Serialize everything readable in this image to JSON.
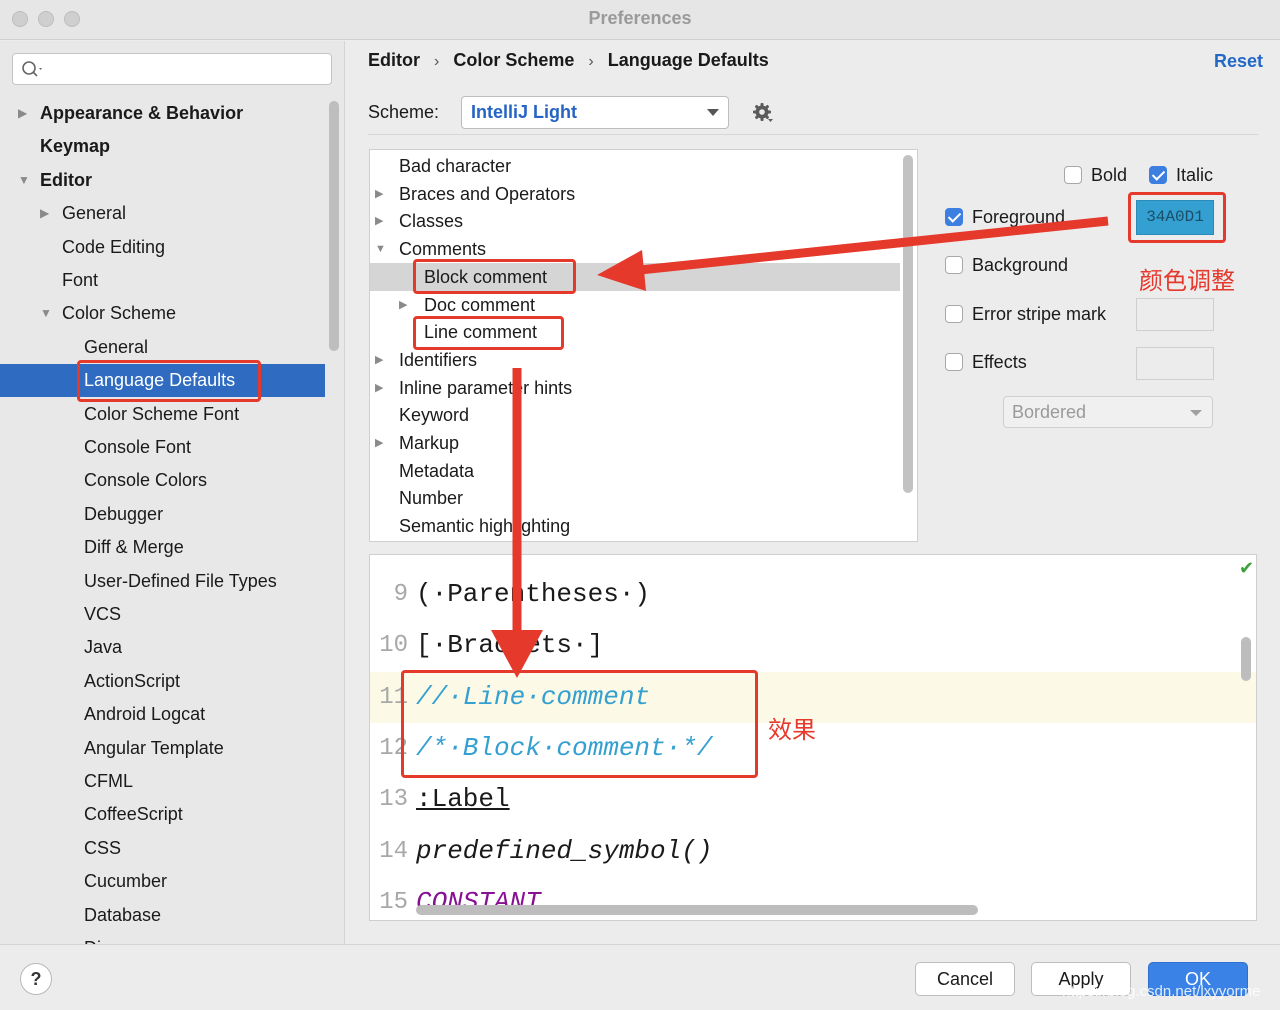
{
  "window": {
    "title": "Preferences"
  },
  "search": {
    "value": "",
    "placeholder": ""
  },
  "sidebar": {
    "items": [
      {
        "label": "Appearance & Behavior",
        "arrow": "▶"
      },
      {
        "label": "Keymap",
        "arrow": ""
      },
      {
        "label": "Editor",
        "arrow": "▼"
      },
      {
        "label": "General",
        "arrow": "▶"
      },
      {
        "label": "Code Editing",
        "arrow": ""
      },
      {
        "label": "Font",
        "arrow": ""
      },
      {
        "label": "Color Scheme",
        "arrow": "▼"
      },
      {
        "label": "General",
        "arrow": ""
      },
      {
        "label": "Language Defaults",
        "arrow": ""
      },
      {
        "label": "Color Scheme Font",
        "arrow": ""
      },
      {
        "label": "Console Font",
        "arrow": ""
      },
      {
        "label": "Console Colors",
        "arrow": ""
      },
      {
        "label": "Debugger",
        "arrow": ""
      },
      {
        "label": "Diff & Merge",
        "arrow": ""
      },
      {
        "label": "User-Defined File Types",
        "arrow": ""
      },
      {
        "label": "VCS",
        "arrow": ""
      },
      {
        "label": "Java",
        "arrow": ""
      },
      {
        "label": "ActionScript",
        "arrow": ""
      },
      {
        "label": "Android Logcat",
        "arrow": ""
      },
      {
        "label": "Angular Template",
        "arrow": ""
      },
      {
        "label": "CFML",
        "arrow": ""
      },
      {
        "label": "CoffeeScript",
        "arrow": ""
      },
      {
        "label": "CSS",
        "arrow": ""
      },
      {
        "label": "Cucumber",
        "arrow": ""
      },
      {
        "label": "Database",
        "arrow": ""
      },
      {
        "label": "Diagrams",
        "arrow": ""
      }
    ]
  },
  "breadcrumb": {
    "items": [
      "Editor",
      "Color Scheme",
      "Language Defaults"
    ],
    "separator": "›"
  },
  "reset_label": "Reset",
  "scheme": {
    "label": "Scheme:",
    "value": "IntelliJ Light"
  },
  "attributes": {
    "items": [
      {
        "label": "Bad character",
        "arrow": ""
      },
      {
        "label": "Braces and Operators",
        "arrow": "▶"
      },
      {
        "label": "Classes",
        "arrow": "▶"
      },
      {
        "label": "Comments",
        "arrow": "▼"
      },
      {
        "label": "Block comment",
        "arrow": ""
      },
      {
        "label": "Doc comment",
        "arrow": "▶"
      },
      {
        "label": "Line comment",
        "arrow": ""
      },
      {
        "label": "Identifiers",
        "arrow": "▶"
      },
      {
        "label": "Inline parameter hints",
        "arrow": "▶"
      },
      {
        "label": "Keyword",
        "arrow": ""
      },
      {
        "label": "Markup",
        "arrow": "▶"
      },
      {
        "label": "Metadata",
        "arrow": ""
      },
      {
        "label": "Number",
        "arrow": ""
      },
      {
        "label": "Semantic highlighting",
        "arrow": ""
      }
    ]
  },
  "options": {
    "bold": {
      "label": "Bold",
      "checked": false
    },
    "italic": {
      "label": "Italic",
      "checked": true
    },
    "foreground": {
      "label": "Foreground",
      "checked": true,
      "color": "34A0D1"
    },
    "background": {
      "label": "Background",
      "checked": false
    },
    "error_stripe": {
      "label": "Error stripe mark",
      "checked": false
    },
    "effects": {
      "label": "Effects",
      "checked": false,
      "type": "Bordered"
    }
  },
  "preview": {
    "lines": [
      {
        "number": "9",
        "text": "(·Parentheses·)",
        "style": "plain"
      },
      {
        "number": "10",
        "text": "[·Brackets·]",
        "style": "plain"
      },
      {
        "number": "11",
        "text": "//·Line·comment",
        "style": "comment"
      },
      {
        "number": "12",
        "text": "/*·Block·comment·*/",
        "style": "comment"
      },
      {
        "number": "13",
        "text": ":Label",
        "style": "label"
      },
      {
        "number": "14",
        "text": "predefined_symbol()",
        "style": "italic"
      },
      {
        "number": "15",
        "text": "CONSTANT",
        "style": "const"
      }
    ]
  },
  "footer": {
    "help": "?",
    "cancel": "Cancel",
    "apply": "Apply",
    "ok": "OK",
    "watermark": "https://blog.csdn.net/lxyyorme"
  },
  "annotations": {
    "color_adjust": "颜色调整",
    "effect": "效果"
  },
  "colors": {
    "accent": "#2f6bc0",
    "comment": "#34a0d1",
    "annotation": "#e5392c"
  }
}
